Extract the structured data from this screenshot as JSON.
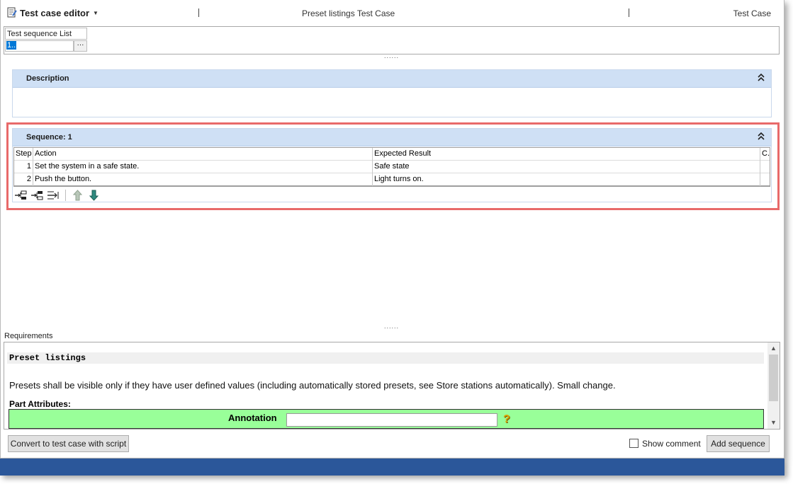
{
  "header": {
    "app_title": "Test case editor",
    "middle_title": "Preset listings Test Case",
    "right_title": "Test Case"
  },
  "test_sequence_list": {
    "label": "Test sequence List",
    "value": "1..",
    "ellipsis": "···"
  },
  "splitter": "......",
  "description_panel": {
    "title": "Description",
    "collapse_glyph": "˄˄"
  },
  "sequence_panel": {
    "title": "Sequence: 1",
    "collapse_glyph": "˄˄",
    "columns": [
      "Step",
      "Action",
      "Expected Result",
      "C."
    ],
    "rows": [
      {
        "step": "1",
        "action": "Set the system in a safe state.",
        "expected": "Safe state",
        "c": ""
      },
      {
        "step": "2",
        "action": "Push the button.",
        "expected": "Light turns on.",
        "c": ""
      }
    ],
    "toolbar_icons": [
      "insert-step-icon",
      "insert-step-below-icon",
      "insert-call-icon",
      "move-up-icon",
      "move-down-icon"
    ]
  },
  "requirements": {
    "label": "Requirements",
    "heading": "Preset listings",
    "text": "Presets shall be visible only if they have user defined values (including automatically stored presets, see Store stations automatically).  Small change.",
    "part_attributes_label": "Part Attributes:",
    "annotation_label": "Annotation",
    "annotation_value": "",
    "help_glyph": "?"
  },
  "footer": {
    "convert_button": "Convert to test case with script",
    "show_comment_label": "Show comment",
    "show_comment_checked": false,
    "add_sequence_button": "Add sequence"
  },
  "colors": {
    "panel_header": "#cfe0f5",
    "highlight_border": "#e86a6a",
    "annotation_bg": "#99ff99",
    "taskbar": "#2b579a"
  }
}
